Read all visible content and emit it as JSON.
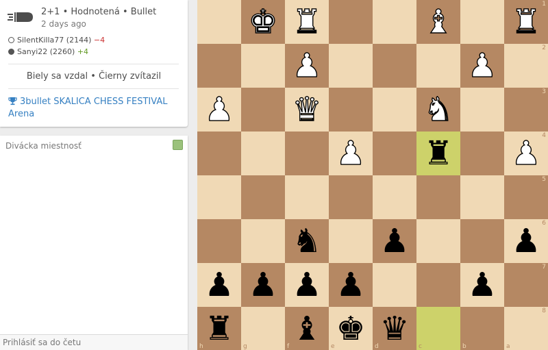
{
  "game": {
    "icon": "bullet-icon",
    "setup": "2+1 • Hodnotená • Bullet",
    "date": "2 days ago",
    "white_player": {
      "name": "SilentKilla77",
      "rating": "(2144)",
      "diff": "−4"
    },
    "black_player": {
      "name": "Sanyi22",
      "rating": "(2260)",
      "diff": "+4"
    },
    "result": "Biely sa vzdal • Čierny zvítazil",
    "tournament": "3bullet SKALICA CHESS FESTIVAL Arena"
  },
  "chat": {
    "title": "Divácka miestnosť",
    "placeholder": "Prihlásiť sa do četu",
    "toggle_color": "#9bc27c"
  },
  "board": {
    "orientation": "black",
    "colors": {
      "light": "#f0d9b5",
      "dark": "#b58863",
      "highlight_light": "#cdd26a",
      "highlight_dark": "#aaa23a"
    },
    "last_move": [
      "c4",
      "c8"
    ],
    "pieces": {
      "g1": "wK",
      "f1": "wR",
      "c1": "wB",
      "a1": "wR",
      "f2": "wP",
      "b2": "wP",
      "h3": "wP",
      "f3": "wQ",
      "c3": "wN",
      "e4": "wP",
      "a4": "wP",
      "c4": "bR",
      "f6": "bN",
      "d6": "bP",
      "a6": "bP",
      "h7": "bP",
      "g7": "bP",
      "f7": "bP",
      "e7": "bP",
      "b7": "bP",
      "h8": "bR",
      "f8": "bB",
      "e8": "bK",
      "d8": "bQ"
    },
    "glyphs": {
      "K": "♚",
      "Q": "♛",
      "R": "♜",
      "B": "♝",
      "N": "♞",
      "P": "♟"
    },
    "piece_names": {
      "K": "king",
      "Q": "queen",
      "R": "rook",
      "B": "bishop",
      "N": "knight",
      "P": "pawn"
    }
  }
}
